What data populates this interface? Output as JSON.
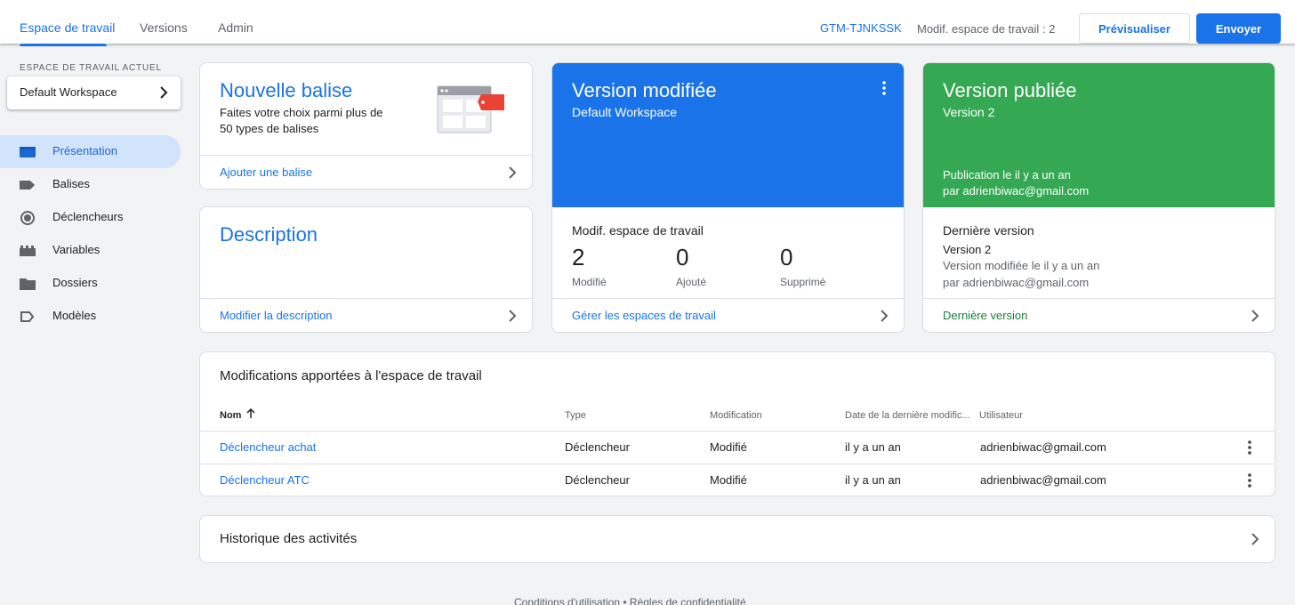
{
  "header": {
    "tabs": [
      {
        "label": "Espace de travail",
        "active": true
      },
      {
        "label": "Versions",
        "active": false
      },
      {
        "label": "Admin",
        "active": false
      }
    ],
    "container_id": "GTM-TJNKSSK",
    "workspace_changes": "Modif. espace de travail : 2",
    "preview_label": "Prévisualiser",
    "send_label": "Envoyer"
  },
  "sidebar": {
    "current_workspace_label": "ESPACE DE TRAVAIL ACTUEL",
    "workspace_name": "Default Workspace",
    "items": [
      {
        "label": "Présentation",
        "icon": "overview-icon",
        "active": true
      },
      {
        "label": "Balises",
        "icon": "tag-icon",
        "active": false
      },
      {
        "label": "Déclencheurs",
        "icon": "trigger-icon",
        "active": false
      },
      {
        "label": "Variables",
        "icon": "variables-icon",
        "active": false
      },
      {
        "label": "Dossiers",
        "icon": "folder-icon",
        "active": false
      },
      {
        "label": "Modèles",
        "icon": "template-icon",
        "active": false
      }
    ]
  },
  "new_tag": {
    "title": "Nouvelle balise",
    "desc_line1": "Faites votre choix parmi plus de",
    "desc_line2": "50 types de balises",
    "link": "Ajouter une balise"
  },
  "description": {
    "title": "Description",
    "link": "Modifier la description"
  },
  "modified_version": {
    "title": "Version modifiée",
    "workspace": "Default Workspace",
    "section_title": "Modif. espace de travail",
    "stats": [
      {
        "value": "2",
        "label": "Modifié"
      },
      {
        "value": "0",
        "label": "Ajouté"
      },
      {
        "value": "0",
        "label": "Supprimé"
      }
    ],
    "link": "Gérer les espaces de travail"
  },
  "published_version": {
    "title": "Version publiée",
    "version": "Version 2",
    "published_line1": "Publication le il y a un an",
    "published_line2": "par adrienbiwac@gmail.com",
    "last_title": "Dernière version",
    "last_version": "Version 2",
    "last_line1": "Version modifiée le il y a un an",
    "last_line2": "par adrienbiwac@gmail.com",
    "link": "Dernière version"
  },
  "changes": {
    "title": "Modifications apportées à l'espace de travail",
    "columns": [
      "Nom",
      "Type",
      "Modification",
      "Date de la dernière modific...",
      "Utilisateur"
    ],
    "rows": [
      {
        "name": "Déclencheur achat",
        "type": "Déclencheur",
        "change": "Modifié",
        "date": "il y a un an",
        "user": "adrienbiwac@gmail.com"
      },
      {
        "name": "Déclencheur ATC",
        "type": "Déclencheur",
        "change": "Modifié",
        "date": "il y a un an",
        "user": "adrienbiwac@gmail.com"
      }
    ]
  },
  "activity": {
    "title": "Historique des activités"
  },
  "footer": {
    "links": "Conditions d'utilisation  •  Règles de confidentialité"
  },
  "colors": {
    "accent": "#1a73e8",
    "green": "#34a853",
    "tag_red": "#ea4335"
  }
}
